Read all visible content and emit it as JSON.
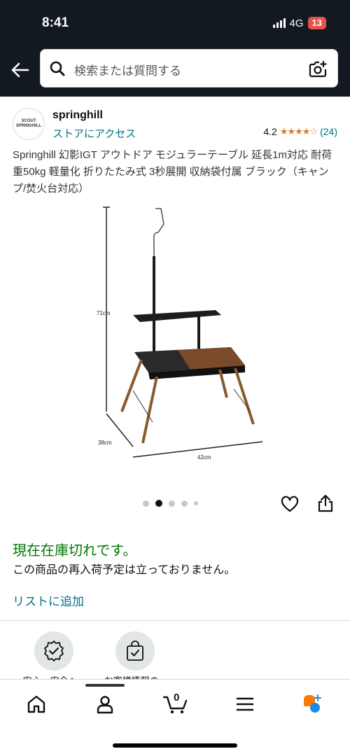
{
  "status_bar": {
    "time": "8:41",
    "network": "4G",
    "battery": "13"
  },
  "search": {
    "placeholder": "検索または質問する"
  },
  "store": {
    "logo_text": "SCOUT SPRINGHILL",
    "name": "springhill",
    "visit_label": "ストアにアクセス",
    "rating_value": "4.2",
    "rating_stars": 4.2,
    "rating_count": "(24)"
  },
  "product": {
    "title": "Springhill 幻影IGT アウトドア モジュラーテーブル 延長1m対応 耐荷重50kg 軽量化 折りたたみ式 3秒展開 収納袋付属 ブラック（キャンプ/焚火台対応）",
    "image_labels": {
      "height": "71cm",
      "depth": "38cm",
      "width": "42cm"
    },
    "carousel": {
      "count": 5,
      "active_index": 1
    }
  },
  "availability": {
    "status": "現在在庫切れです。",
    "note": "この商品の再入荷予定は立っておりません。",
    "add_to_list": "リストに追加"
  },
  "badges": [
    {
      "label": "安心・安全へ...",
      "icon": "shield-check-icon"
    },
    {
      "label": "お客様情報の...",
      "icon": "bag-check-icon"
    }
  ],
  "bottom_nav": [
    {
      "name": "home",
      "icon": "home-icon"
    },
    {
      "name": "account",
      "icon": "person-icon"
    },
    {
      "name": "cart",
      "icon": "cart-icon",
      "count": "0"
    },
    {
      "name": "menu",
      "icon": "menu-icon"
    },
    {
      "name": "rufus",
      "icon": "rufus-icon"
    }
  ],
  "colors": {
    "header_bg": "#131921",
    "link": "#007185",
    "in_stock_green": "#007600",
    "star": "#de7921",
    "battery": "#e8504d"
  }
}
